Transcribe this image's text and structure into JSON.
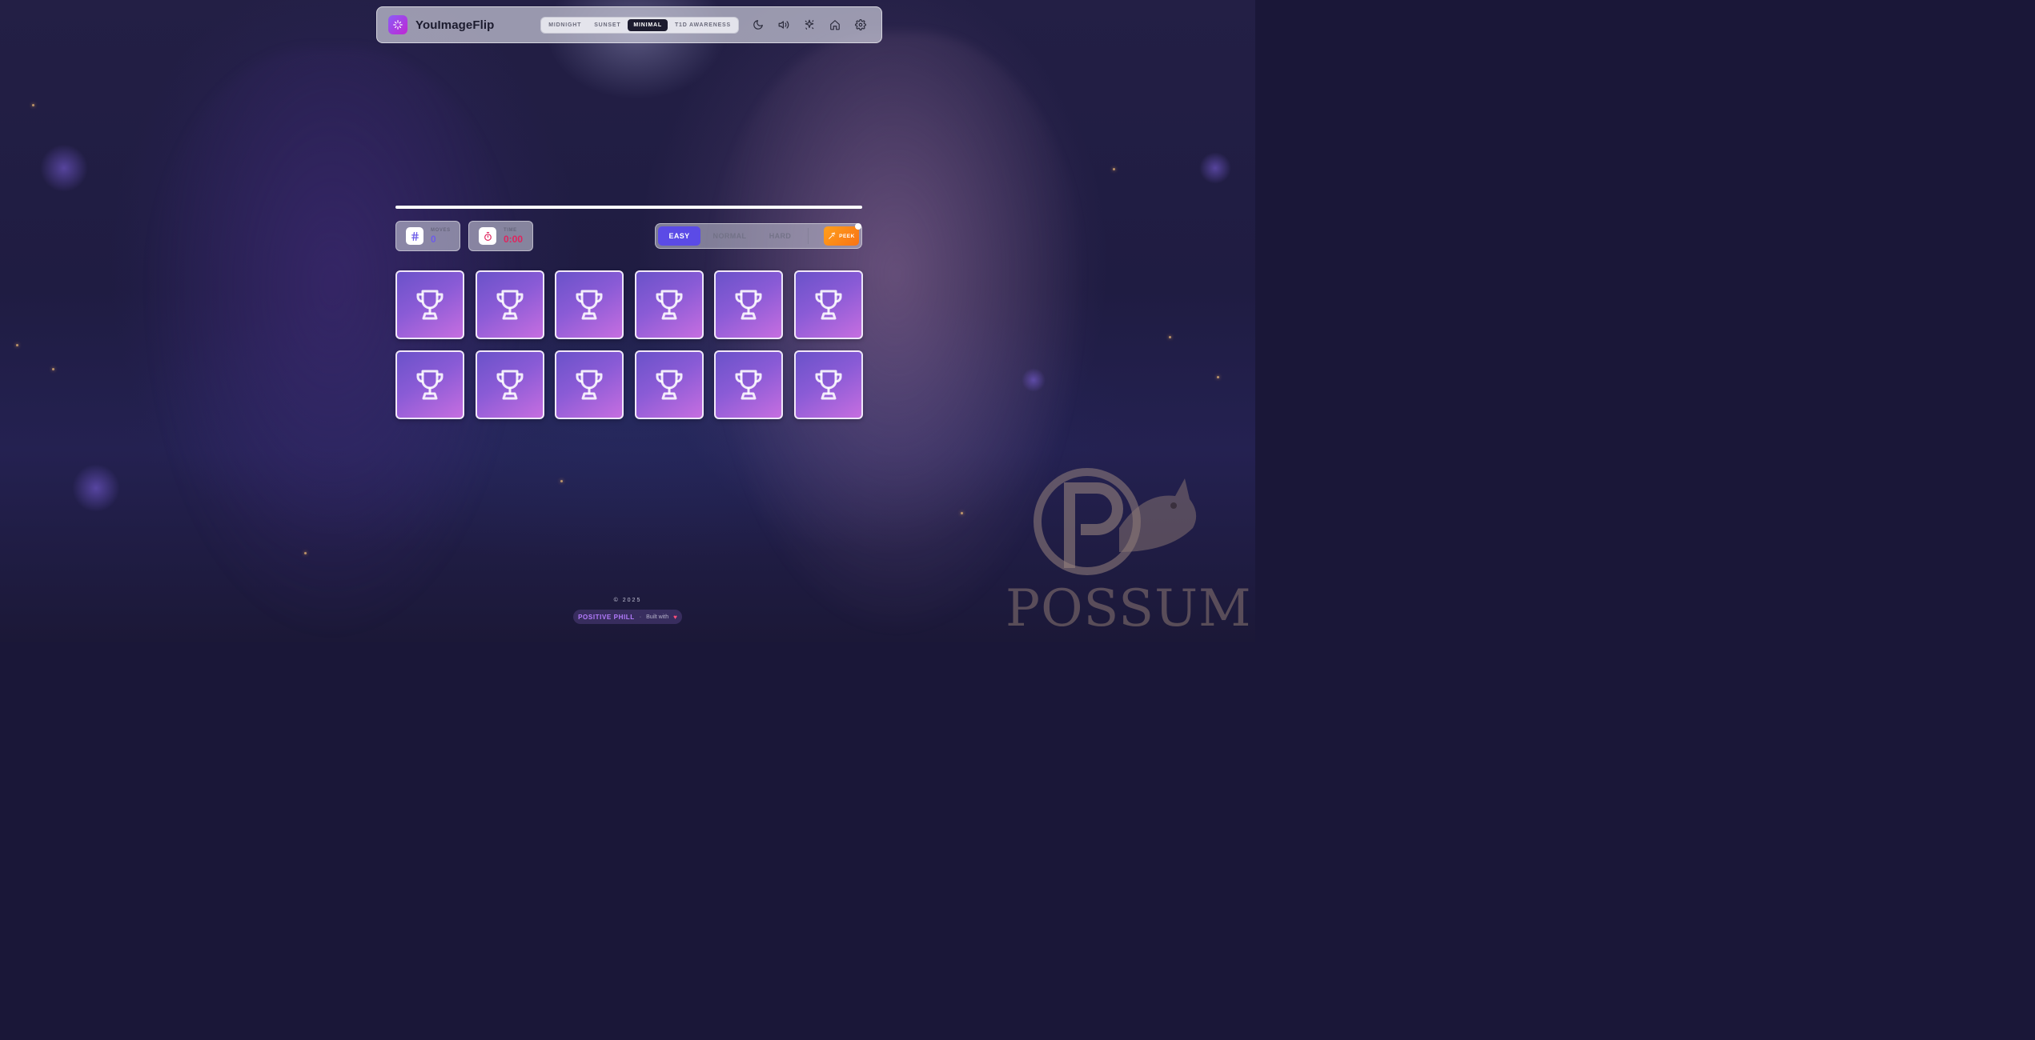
{
  "app": {
    "title": "YouImageFlip"
  },
  "header": {
    "themes": [
      {
        "label": "MIDNIGHT",
        "active": false
      },
      {
        "label": "SUNSET",
        "active": false
      },
      {
        "label": "MINIMAL",
        "active": true
      },
      {
        "label": "T1D AWARENESS",
        "active": false
      }
    ],
    "icons": [
      "moon-icon",
      "volume-icon",
      "sparkle-icon",
      "home-icon",
      "settings-icon"
    ]
  },
  "game": {
    "progress": 1.0,
    "stats": {
      "moves": {
        "label": "MOVES",
        "value": "0"
      },
      "time": {
        "label": "TIME",
        "value": "0:00"
      }
    },
    "difficulty": {
      "options": [
        {
          "label": "EASY",
          "active": true
        },
        {
          "label": "NORMAL",
          "active": false
        },
        {
          "label": "HARD",
          "active": false
        }
      ],
      "peek_label": "PEEK"
    },
    "cards": {
      "count": 12,
      "columns": 6,
      "face_down_icon": "trophy-icon"
    }
  },
  "footer": {
    "copyright": "© 2025",
    "author": "POSITIVE PHILL",
    "separator": "·",
    "built_with": "Built with",
    "heart": "♥"
  },
  "watermark": {
    "text": "POSSUM"
  },
  "colors": {
    "accent": "#5b4be6",
    "card_gradient_start": "#6a52c9",
    "card_gradient_end": "#c66ee0",
    "peek": "#f97316",
    "time_value": "#e0245e",
    "moves_value": "#6d5ce8"
  }
}
